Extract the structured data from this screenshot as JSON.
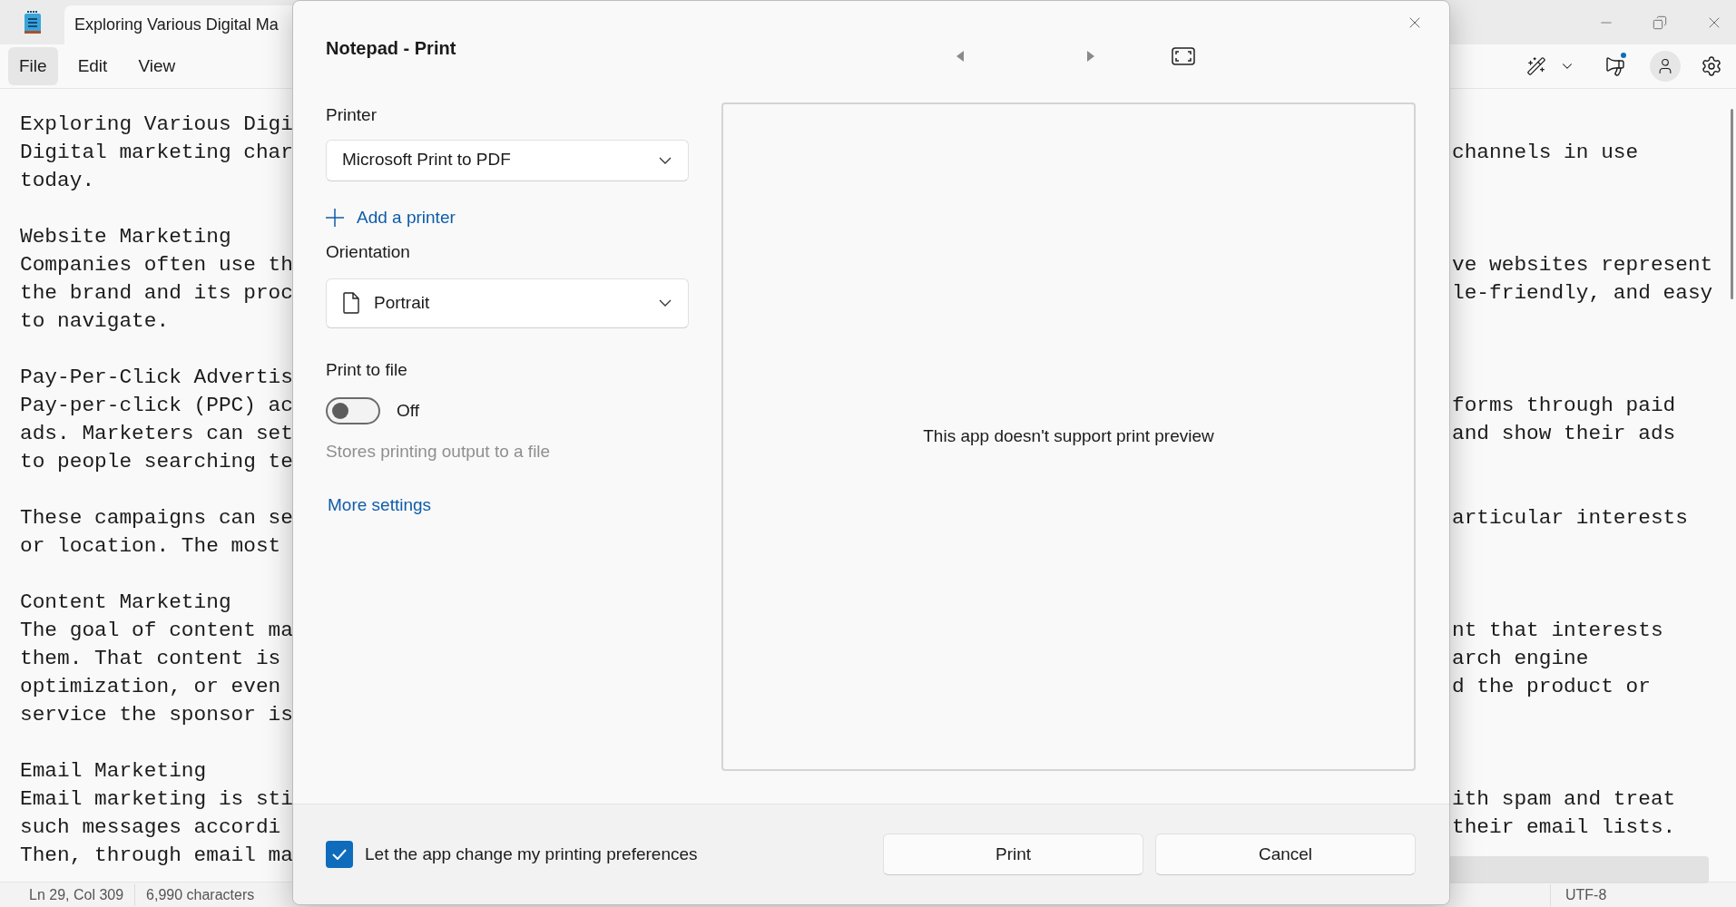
{
  "notepad": {
    "tab_title": "Exploring Various Digital Ma",
    "menu": [
      {
        "label": "File",
        "selected": true
      },
      {
        "label": "Edit",
        "selected": false
      },
      {
        "label": "View",
        "selected": false
      }
    ],
    "lines": [
      {
        "kind": "text",
        "left": "Exploring Various Digi"
      },
      {
        "left": "Digital marketing char",
        "right": "channels in use"
      },
      {
        "left": "today."
      },
      {
        "kind": "blank"
      },
      {
        "left": "Website Marketing"
      },
      {
        "left": "Companies often use th",
        "right": "ve websites represent"
      },
      {
        "left": "the brand and its proc",
        "right": "le-friendly, and easy"
      },
      {
        "left": "to navigate."
      },
      {
        "kind": "blank"
      },
      {
        "left": "Pay-Per-Click Advertis"
      },
      {
        "left": "Pay-per-click (PPC) ac",
        "right": "forms through paid"
      },
      {
        "left": "ads. Marketers can set",
        "right": "and show their ads"
      },
      {
        "left": "to people searching te"
      },
      {
        "kind": "blank"
      },
      {
        "left": "These campaigns can se",
        "right": "articular interests"
      },
      {
        "left": "or location. The most"
      },
      {
        "kind": "blank"
      },
      {
        "left": "Content Marketing"
      },
      {
        "left": "The goal of content ma",
        "right": "nt that interests"
      },
      {
        "left": "them. That content is",
        "right": "arch engine"
      },
      {
        "left": "optimization, or even",
        "right": "d the product or"
      },
      {
        "left": "service the sponsor is"
      },
      {
        "kind": "blank"
      },
      {
        "left": "Email Marketing"
      },
      {
        "left": "Email marketing is sti",
        "right": "ith spam and treat"
      },
      {
        "left": "such messages accordi",
        "right": "their email lists."
      },
      {
        "left": "Then, through email ma"
      }
    ],
    "status_left": [
      "Ln 29, Col 309",
      "6,990 characters"
    ],
    "status_right": [
      "UTF-8"
    ]
  },
  "dialog": {
    "title": "Notepad - Print",
    "printer_label": "Printer",
    "printer_value": "Microsoft Print to PDF",
    "add_printer": "Add a printer",
    "orientation_label": "Orientation",
    "orientation_value": "Portrait",
    "print_to_file": {
      "label": "Print to file",
      "on": false,
      "state_label": "Off",
      "hint": "Stores printing output to a file"
    },
    "more_settings": "More settings",
    "preview_message": "This app doesn't support print preview",
    "preferences": {
      "checked": true,
      "label": "Let the app change my printing preferences"
    },
    "buttons": [
      "Print",
      "Cancel"
    ]
  }
}
